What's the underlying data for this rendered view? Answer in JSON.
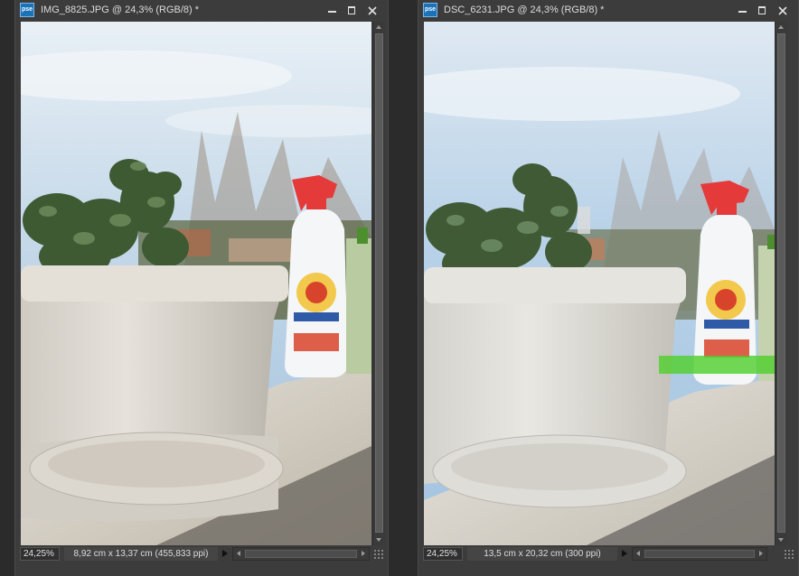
{
  "windows": [
    {
      "id": "left",
      "app_badge": "pse",
      "title": "IMG_8825.JPG @ 24,3% (RGB/8) *",
      "zoom": "24,25%",
      "doc_info": "8,92 cm x 13,37 cm (455,833 ppi)"
    },
    {
      "id": "right",
      "app_badge": "pse",
      "title": "DSC_6231.JPG @ 24,3% (RGB/8) *",
      "zoom": "24,25%",
      "doc_info": "13,5 cm x 20,32 cm (300 ppi)"
    }
  ],
  "icons": {
    "minimize": "minimize-icon",
    "maximize": "maximize-icon",
    "close": "close-icon",
    "info_menu": "triangle-right-icon",
    "resize": "resize-grip-icon"
  },
  "colors": {
    "app_badge": "#1a72b8",
    "window_bg": "#3c3c3c",
    "workspace_bg": "#2b2b2b"
  }
}
